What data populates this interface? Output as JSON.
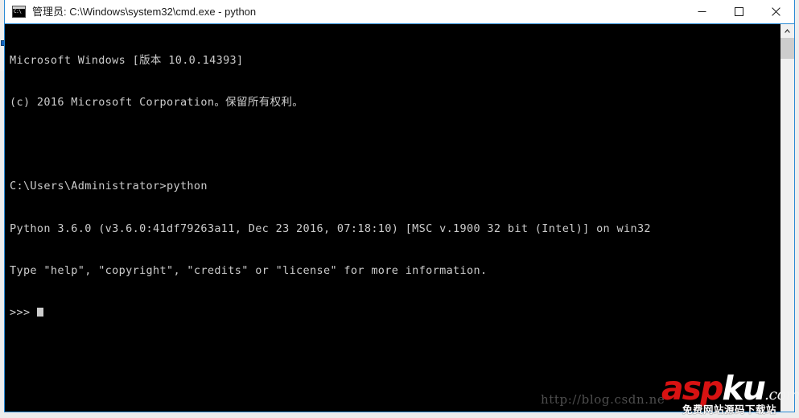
{
  "window": {
    "title": "管理员: C:\\Windows\\system32\\cmd.exe - python",
    "icon_name": "cmd-console-icon",
    "controls": {
      "minimize_label": "Minimize",
      "maximize_label": "Maximize",
      "close_label": "Close"
    },
    "border_color": "#2a8ad4",
    "titlebar_bg": "#ffffff",
    "titlebar_fg": "#1b1b1b"
  },
  "console": {
    "background": "#000000",
    "foreground": "#cccccc",
    "lines": [
      "Microsoft Windows [版本 10.0.14393]",
      "(c) 2016 Microsoft Corporation。保留所有权利。",
      "",
      "C:\\Users\\Administrator>python",
      "Python 3.6.0 (v3.6.0:41df79263a11, Dec 23 2016, 07:18:10) [MSC v.1900 32 bit (Intel)] on win32",
      "Type \"help\", \"copyright\", \"credits\" or \"license\" for more information.",
      ">>> "
    ],
    "prompt": ">>> ",
    "cursor_visible": true
  },
  "scrollbar": {
    "up_arrow_name": "scroll-up-arrow",
    "thumb_name": "scrollbar-thumb",
    "track_name": "scrollbar-track"
  },
  "watermark": {
    "url": "http://blog.csdn.ne",
    "logo_asp": "asp",
    "logo_ku": "ku",
    "logo_com": ".com",
    "tagline": "免费网站源码下载站",
    "logo_red": "#d81212",
    "logo_white": "#ffffff"
  }
}
